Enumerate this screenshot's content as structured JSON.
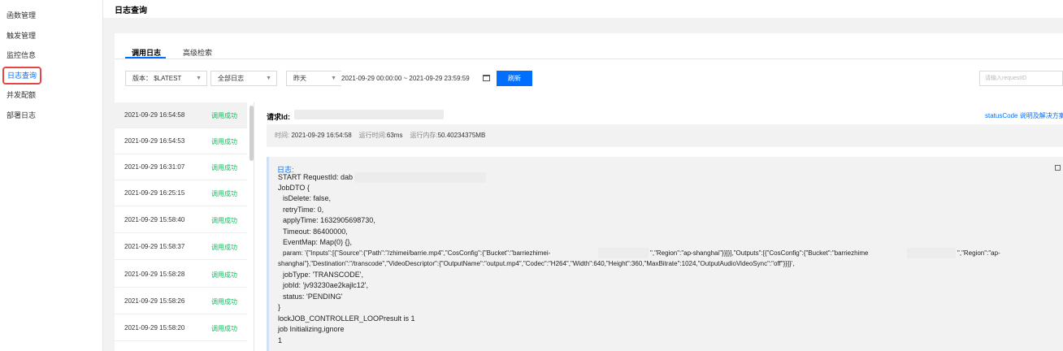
{
  "sidebar": {
    "items": [
      {
        "label": "函数管理"
      },
      {
        "label": "触发管理"
      },
      {
        "label": "监控信息"
      },
      {
        "label": "日志查询"
      },
      {
        "label": "并发配额"
      },
      {
        "label": "部署日志"
      }
    ],
    "active_index": 3
  },
  "page": {
    "title": "日志查询"
  },
  "tabs": [
    {
      "label": "调用日志",
      "active": true
    },
    {
      "label": "高级检索",
      "active": false
    }
  ],
  "filters": {
    "version": "版本： $LATEST",
    "log_type": "全部日志",
    "range": "昨天",
    "date_range": "2021-09-29 00:00:00 ~ 2021-09-29 23:59:59",
    "refresh_label": "刷新",
    "search_placeholder": "请输入requestID"
  },
  "log_list": [
    {
      "time": "2021-09-29 16:54:58",
      "status": "调用成功"
    },
    {
      "time": "2021-09-29 16:54:53",
      "status": "调用成功"
    },
    {
      "time": "2021-09-29 16:31:07",
      "status": "调用成功"
    },
    {
      "time": "2021-09-29 16:25:15",
      "status": "调用成功"
    },
    {
      "time": "2021-09-29 15:58:40",
      "status": "调用成功"
    },
    {
      "time": "2021-09-29 15:58:37",
      "status": "调用成功"
    },
    {
      "time": "2021-09-29 15:58:28",
      "status": "调用成功"
    },
    {
      "time": "2021-09-29 15:58:26",
      "status": "调用成功"
    },
    {
      "time": "2021-09-29 15:58:20",
      "status": "调用成功"
    }
  ],
  "detail": {
    "request_label": "请求Id:",
    "help_link": "statusCode 说明及解决方案",
    "time_label": "时间:",
    "time_value": "2021-09-29 16:54:58",
    "duration_label": "运行时间:",
    "duration_value": "63ms",
    "memory_label": "运行内存:",
    "memory_value": "50.40234375MB",
    "log_title": "日志:",
    "log_lines": [
      "START RequestId: dab",
      "JobDTO {",
      "  isDelete: false,",
      "  retryTime: 0,",
      "  applyTime: 1632905698730,",
      "  Timeout: 86400000,",
      "  EventMap: Map(0) {},",
      "  param: '{\"Inputs\":[{\"Source\":{\"Path\":\"/zhimei/barrie.mp4\",\"CosConfig\":{\"Bucket\":\"barriezhimei-",
      "shanghai\"},\"Destination\":\"/transcode\",\"VideoDescriptor\":{\"OutputName\":\"output.mp4\",\"Codec\":\"H264\",\"Width\":640,\"Height\":360,\"MaxBitrate\":1024,\"OutputAudioVideoSync\":\"off\"}}]}',",
      "  jobType: 'TRANSCODE',",
      "  jobId: 'jv93230ae2kajlc12',",
      "  status: 'PENDING'",
      "}",
      "lockJOB_CONTROLLER_LOOPresult is 1",
      "job Initializing,ignore",
      "1"
    ],
    "param_mid": "\",\"Region\":\"ap-shanghai\"}}]}],\"Outputs\":[{\"CosConfig\":{\"Bucket\":\"barriezhime",
    "param_end": "\",\"Region\":\"ap-"
  }
}
